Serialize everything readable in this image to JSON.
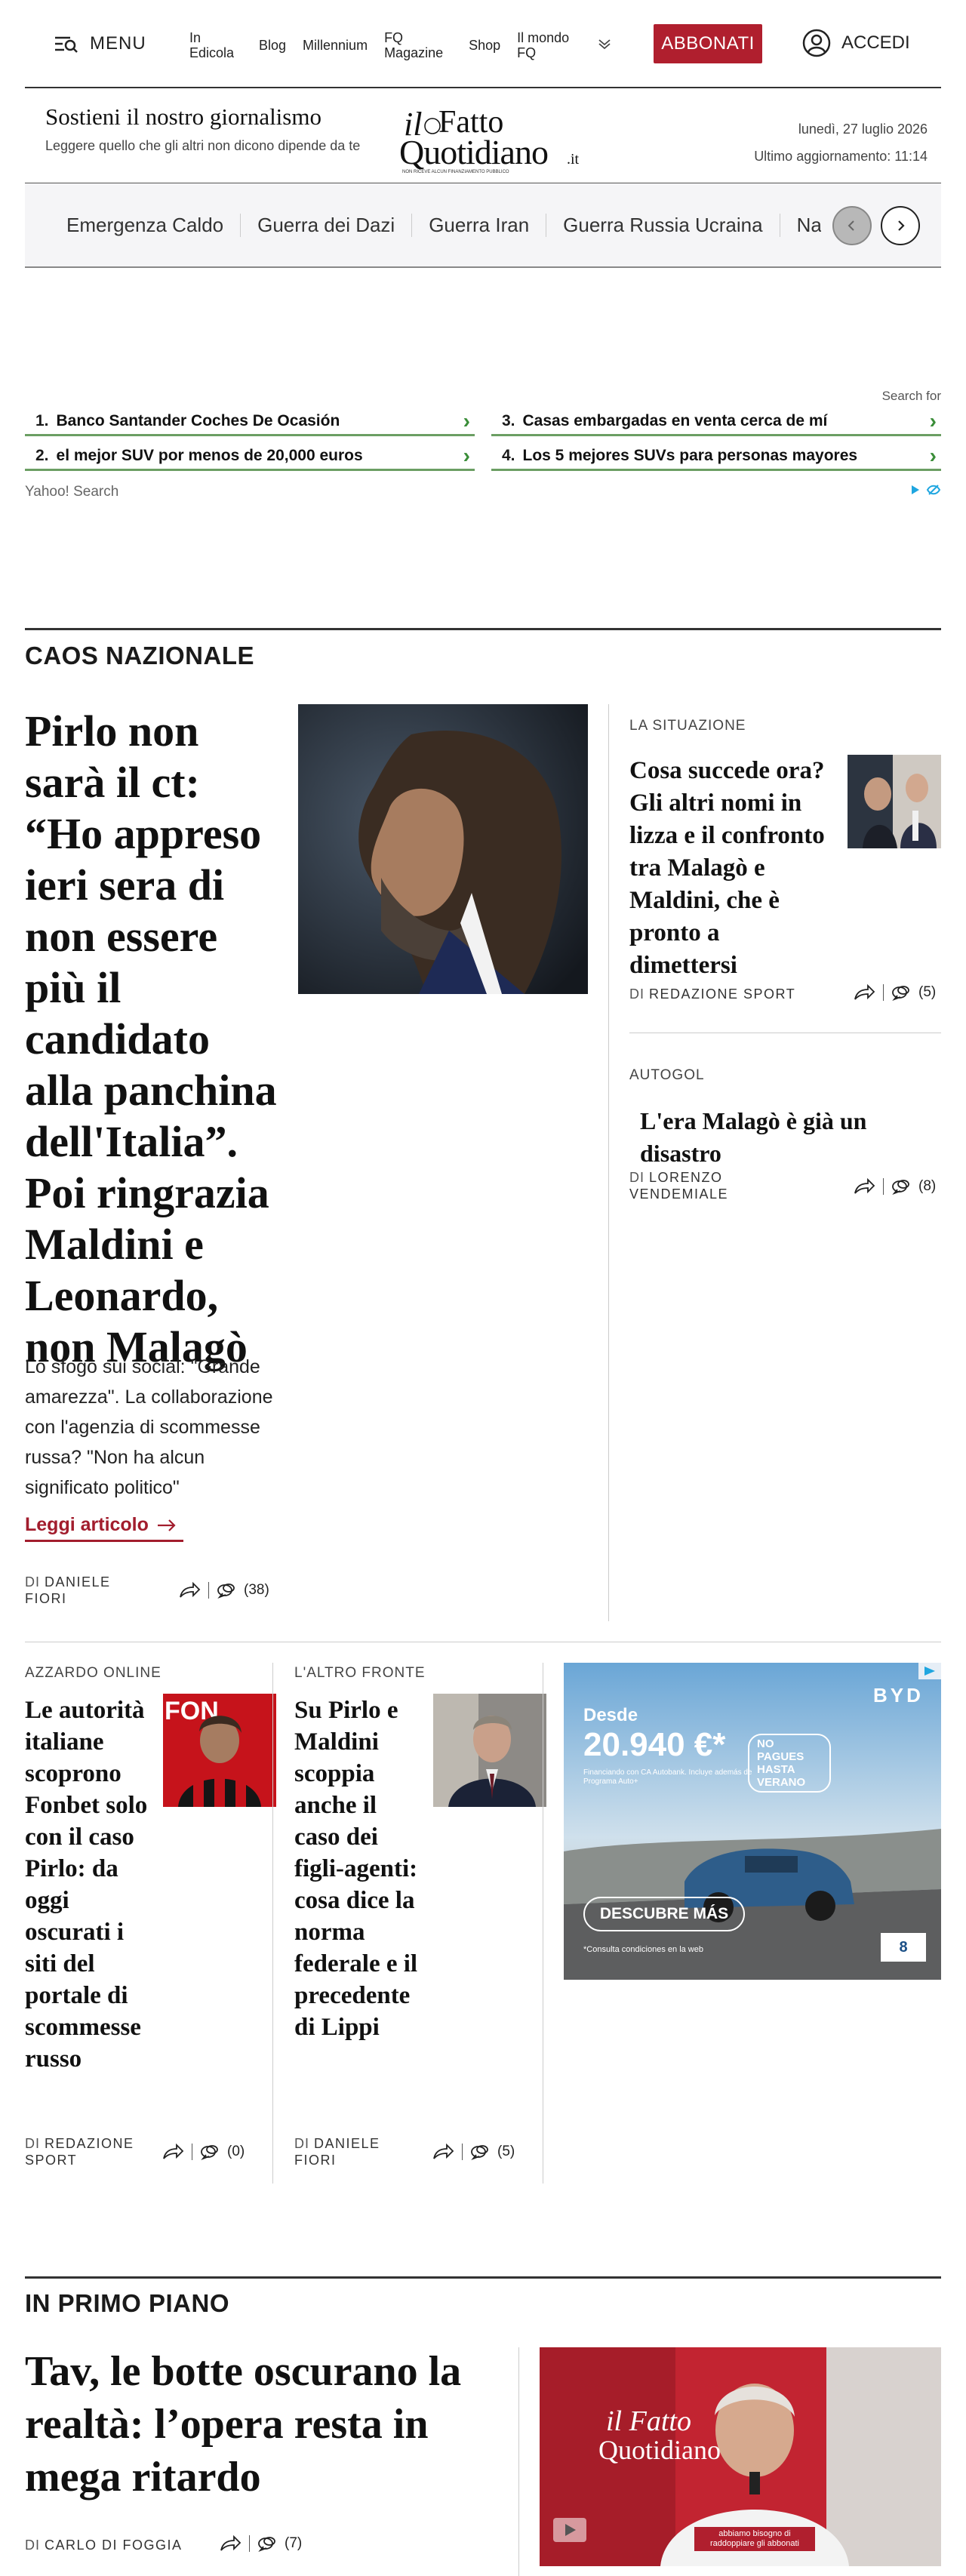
{
  "nav": {
    "menu_label": "MENU",
    "links": [
      "In Edicola",
      "Blog",
      "Millennium",
      "FQ Magazine",
      "Shop",
      "Il mondo FQ"
    ],
    "subscribe_label": "ABBONATI",
    "login_label": "ACCEDI"
  },
  "masthead": {
    "support_title": "Sostieni il nostro giornalismo",
    "support_subtitle": "Leggere quello che gli altri non dicono dipende da te",
    "logo_line1": "il Fatto",
    "logo_line2": "Quotidiano",
    "logo_suffix": ".it",
    "logo_tagline": "NON RICEVE ALCUN FINANZIAMENTO PUBBLICO",
    "date": "lunedì, 27 luglio 2026",
    "updated": "Ultimo aggiornamento: 11:14"
  },
  "topics": [
    "Emergenza Caldo",
    "Guerra dei Dazi",
    "Guerra Iran",
    "Guerra Russia Ucraina",
    "Na"
  ],
  "search_ad": {
    "search_for": "Search for",
    "items": [
      {
        "num": "1.",
        "text": "Banco Santander Coches De Ocasión"
      },
      {
        "num": "2.",
        "text": "el mejor SUV por menos de 20,000 euros"
      },
      {
        "num": "3.",
        "text": "Casas embargadas en venta cerca de mí"
      },
      {
        "num": "4.",
        "text": "Los 5 mejores SUVs para personas mayores"
      }
    ],
    "provider": "Yahoo! Search"
  },
  "caos": {
    "section_title": "CAOS NAZIONALE",
    "main": {
      "headline": "Pirlo non sarà il ct: “Ho appreso ieri sera di non essere più il candidato alla panchina dell'Italia”. Poi ringrazia Maldini e Leonardo, non Malagò",
      "summary": "Lo sfogo sui social: \"Grande amarezza\". La collaborazione con l'agenzia di scommesse russa? \"Non ha alcun significato politico\"",
      "read_more": "Leggi articolo",
      "by": "DI",
      "author": "DANIELE FIORI",
      "comments": "(38)"
    },
    "side1": {
      "kicker": "LA SITUAZIONE",
      "headline": "Cosa succede ora? Gli altri nomi in lizza e il confronto tra Malagò e Maldini, che è pronto a dimettersi",
      "by": "DI",
      "author": "REDAZIONE SPORT",
      "comments": "(5)"
    },
    "side2": {
      "kicker": "AUTOGOL",
      "headline": "L'era Malagò è già un disastro",
      "by": "DI",
      "author": "LORENZO VENDEMIALE",
      "comments": "(8)"
    },
    "row2a": {
      "kicker": "AZZARDO ONLINE",
      "headline": "Le autorità italiane scoprono Fonbet solo con il caso Pirlo: da oggi oscurati i siti del portale di scommesse russo",
      "by": "DI",
      "author": "REDAZIONE SPORT",
      "comments": "(0)"
    },
    "row2b": {
      "kicker": "L'ALTRO FRONTE",
      "headline": "Su Pirlo e Maldini scoppia anche il caso dei figli-agenti: cosa dice la norma federale e il precedente di Lippi",
      "by": "DI",
      "author": "DANIELE FIORI",
      "comments": "(5)"
    }
  },
  "ad_banner": {
    "brand": "BYD",
    "desde": "Desde",
    "price": "20.940 €*",
    "badge": "NO PAGUES HASTA VERANO",
    "fine": "Financiando con CA Autobank. Incluye además de Programa Auto+",
    "cta": "DESCUBRE MÁS",
    "note": "*Consulta condiciones en la web",
    "label": "8"
  },
  "primo_piano": {
    "section_title": "IN PRIMO PIANO",
    "headline": "Tav, le botte oscurano la realtà: l’opera resta in mega ritardo",
    "by": "DI",
    "author": "CARLO DI FOGGIA",
    "comments": "(7)",
    "video_caption": "abbiamo bisogno di raddoppiare gli abbonati"
  }
}
